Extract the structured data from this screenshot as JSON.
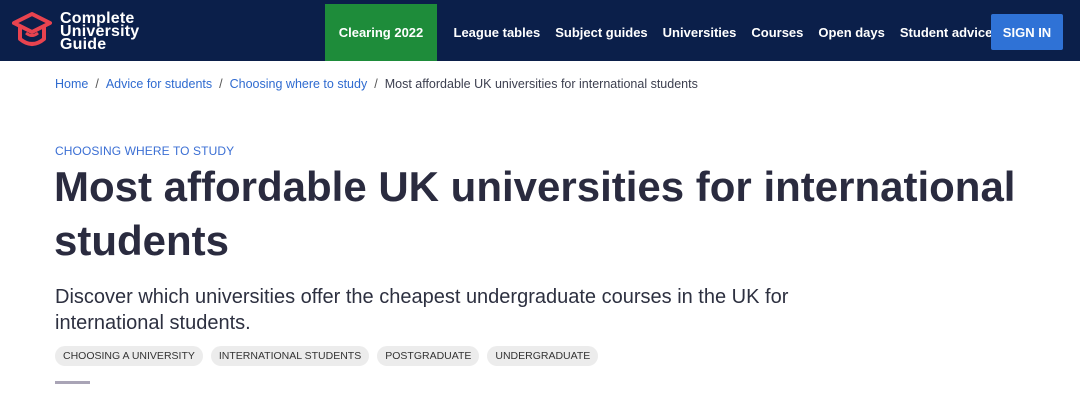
{
  "logo": {
    "line1": "Complete",
    "line2": "University",
    "line3": "Guide"
  },
  "nav": {
    "clearing": "Clearing 2022",
    "links": [
      "League tables",
      "Subject guides",
      "Universities",
      "Courses",
      "Open days",
      "Student advice"
    ],
    "signin": "SIGN IN"
  },
  "breadcrumb": {
    "items": [
      "Home",
      "Advice for students",
      "Choosing where to study"
    ],
    "current": "Most affordable UK universities for international students",
    "separator": "/"
  },
  "article": {
    "kicker": "CHOOSING WHERE TO STUDY",
    "title": "Most affordable UK universities for international students",
    "description": "Discover which universities offer the cheapest undergraduate courses in the UK for international students.",
    "tags": [
      "CHOOSING A UNIVERSITY",
      "INTERNATIONAL STUDENTS",
      "POSTGRADUATE",
      "UNDERGRADUATE"
    ]
  },
  "colors": {
    "header_bg": "#0b1f4a",
    "clearing_bg": "#1e8c3a",
    "signin_bg": "#2f72d6",
    "logo_icon": "#e8434f",
    "link": "#2f6bd0"
  },
  "icons": {
    "logo": "graduation-cap-icon"
  }
}
